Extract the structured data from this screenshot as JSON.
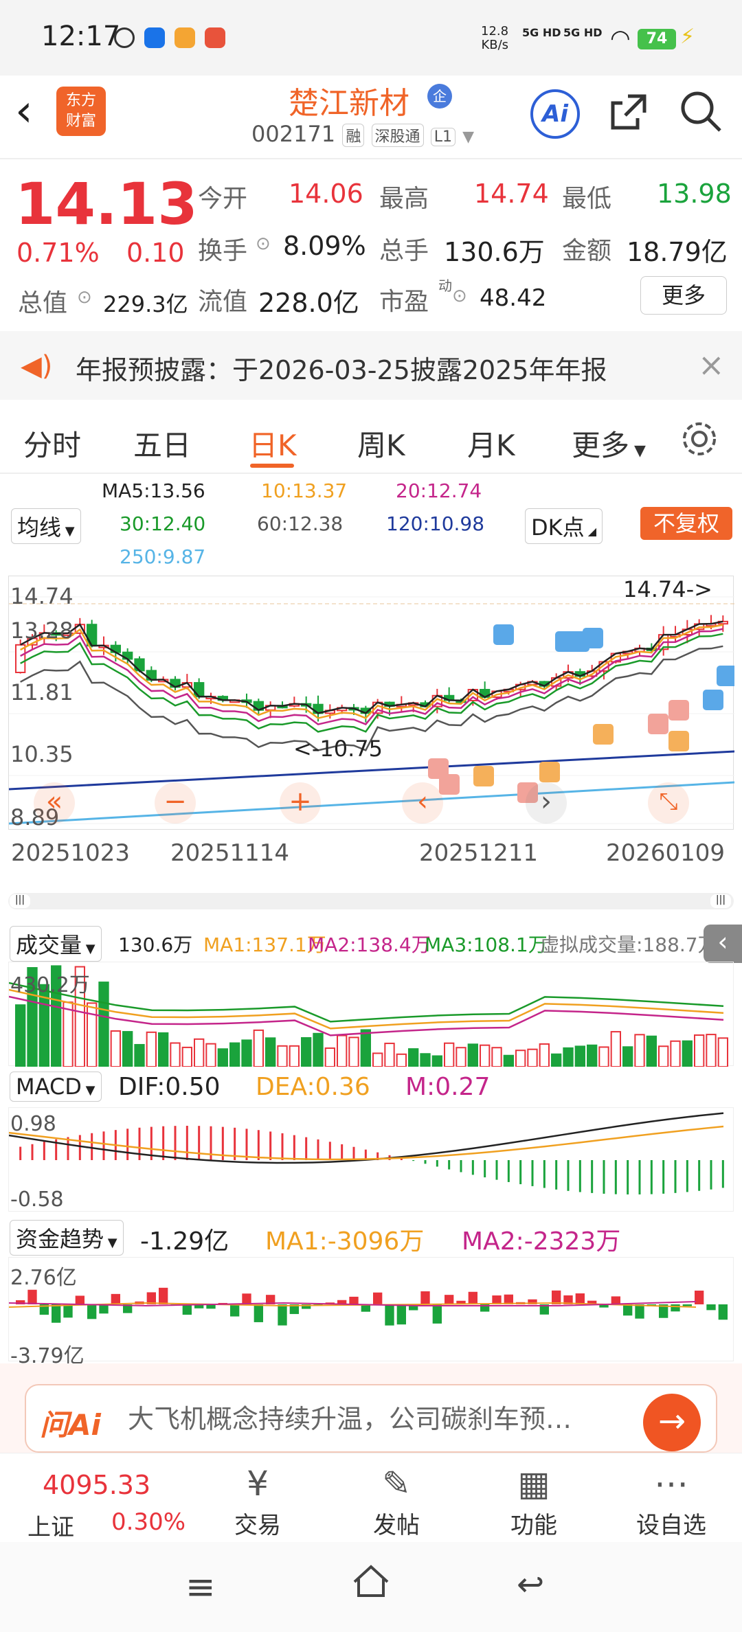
{
  "status": {
    "time": "12:17",
    "speed_top": "12.8",
    "speed_bottom": "KB/s",
    "sig1": "5G HD",
    "sig2": "5G HD",
    "battery": "74"
  },
  "header": {
    "stock_name": "楚江新材",
    "badge": "企",
    "code": "002171",
    "tag1": "融",
    "tag2": "深股通",
    "tag3": "L1",
    "logo_line1": "东方",
    "logo_line2": "财富",
    "ai": "Ai"
  },
  "quote": {
    "price": "14.13",
    "change_pct": "0.71%",
    "change": "0.10",
    "open_label": "今开",
    "open": "14.06",
    "high_label": "最高",
    "high": "14.74",
    "low_label": "最低",
    "low": "13.98",
    "turnover_label": "换手",
    "turnover": "8.09%",
    "volume_label": "总手",
    "volume": "130.6万",
    "amount_label": "金额",
    "amount": "18.79亿",
    "mcap_label": "总值",
    "mcap": "229.3亿",
    "float_label": "流值",
    "float": "228.0亿",
    "pe_label": "市盈",
    "pe_sup": "动",
    "pe": "48.42",
    "more": "更多"
  },
  "notice": {
    "text": "年报预披露：于2026-03-25披露2025年年报"
  },
  "tabs": [
    "分时",
    "五日",
    "日K",
    "周K",
    "月K",
    "更多"
  ],
  "ma": {
    "ma5": "MA5:13.56",
    "ma10": "10:13.37",
    "ma20": "20:12.74",
    "ma30": "30:12.40",
    "ma60": "60:12.38",
    "ma120": "120:10.98",
    "ma250": "250:9.87",
    "selector": "均线",
    "dk": "DK点",
    "restore": "不复权"
  },
  "kchart": {
    "y_labels": [
      "14.74",
      "13.28",
      "11.81",
      "10.35",
      "8.89"
    ],
    "x_labels": [
      "20251023",
      "20251114",
      "20251211",
      "20260109"
    ],
    "high_note": "14.74->",
    "low_note": "<-10.75"
  },
  "volume": {
    "selector": "成交量",
    "val": "130.6万",
    "ma1": "MA1:137.1万",
    "ma2": "MA2:138.4万",
    "ma3": "MA3:108.1万",
    "virtual": "虚拟成交量:188.7万",
    "ymax": "430.2万"
  },
  "macd": {
    "selector": "MACD",
    "dif": "DIF:0.50",
    "dea": "DEA:0.36",
    "m": "M:0.27",
    "ymax": "0.98",
    "ymin": "-0.58"
  },
  "fund": {
    "selector": "资金趋势",
    "val": "-1.29亿",
    "ma1": "MA1:-3096万",
    "ma2": "MA2:-2323万",
    "ymax": "2.76亿",
    "ymin": "-3.79亿"
  },
  "ask": {
    "logo": "问Ai",
    "text": "大飞机概念持续升温，公司碳刹车预…"
  },
  "bottom": {
    "index_val": "4095.33",
    "index_name": "上证",
    "index_pct": "0.30%",
    "trade": "交易",
    "post": "发帖",
    "func": "功能",
    "watch": "设自选"
  }
}
